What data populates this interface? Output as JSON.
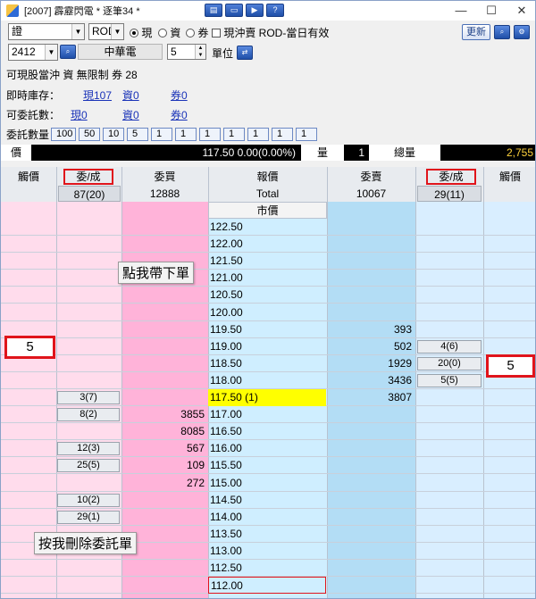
{
  "window": {
    "title": "[2007] 霹靂閃電 * 逐筆34 *",
    "controls": [
      "—",
      "☐",
      "✕"
    ]
  },
  "toolbar": {
    "account": "證",
    "order_type": "ROD",
    "radio_cash": "現",
    "radio_margin": "資",
    "radio_short": "券",
    "checkbox_label": "現沖賣 ROD-當日有效",
    "update_button": "更新",
    "stock_code": "2412",
    "stock_name": "中華電",
    "lot_value": "5",
    "unit_label": "單位"
  },
  "info": {
    "line1": "可現股當沖 資 無限制 券 28",
    "inventory_label": "即時庫存：",
    "inventory_cash": "現107",
    "inventory_margin": "資0",
    "inventory_short": "券0",
    "order_label": "可委託數：",
    "order_cash": "現0",
    "order_margin": "資0",
    "order_short": "券0"
  },
  "quantity": {
    "label": "委託數量",
    "buttons": [
      "100",
      "50",
      "10",
      "5",
      "1",
      "1",
      "1",
      "1",
      "1",
      "1",
      "1"
    ]
  },
  "quote": {
    "price_label": "價",
    "last_value": "117.50 0.00(0.00%)",
    "volume_label": "量",
    "volume_value": "1",
    "total_label": "總量",
    "total_value": "2,755"
  },
  "grid": {
    "headers": {
      "trigger_left": "觸價",
      "order_fill_left": "委/成",
      "bid": "委買",
      "price": "報價",
      "ask": "委賣",
      "order_fill_right": "委/成",
      "trigger_right": "觸價"
    },
    "summary": {
      "left_order_fill": "87(20)",
      "bid_total": "12888",
      "price_total": "Total",
      "ask_total": "10067",
      "right_order_fill": "29(11)"
    },
    "market_label": "市價",
    "prices": [
      "122.50",
      "122.00",
      "121.50",
      "121.00",
      "120.50",
      "120.00",
      "119.50",
      "119.00",
      "118.50",
      "118.00",
      "117.50 (1)",
      "117.00",
      "116.50",
      "116.00",
      "115.50",
      "115.00",
      "114.50",
      "114.00",
      "113.50",
      "113.00",
      "112.50",
      "112.00"
    ],
    "asks": {
      "6": "393",
      "7": "502",
      "8": "1929",
      "9": "3436",
      "10": "3807"
    },
    "bids": {
      "11": "3855",
      "12": "8085",
      "13": "567",
      "14": "109",
      "15": "272"
    },
    "left_orders": {
      "10": "3(7)",
      "11": "8(2)",
      "13": "12(3)",
      "14": "25(5)",
      "16": "10(2)",
      "17": "29(1)"
    },
    "right_orders": {
      "7": "4(6)",
      "8": "20(0)",
      "9": "5(5)"
    },
    "trigger_left_value": "5",
    "trigger_right_value": "5"
  },
  "annotations": {
    "click_hint": "點我帶下單",
    "delete_hint": "按我刪除委託單"
  },
  "colors": {
    "bid_column": "#ffb3d9",
    "ask_column": "#b3ddf5",
    "price_column": "#cfeeff",
    "left_area": "#ffdcec",
    "right_area": "#d9eeff",
    "highlight": "#ffff00",
    "accent_red": "#e0141b"
  }
}
